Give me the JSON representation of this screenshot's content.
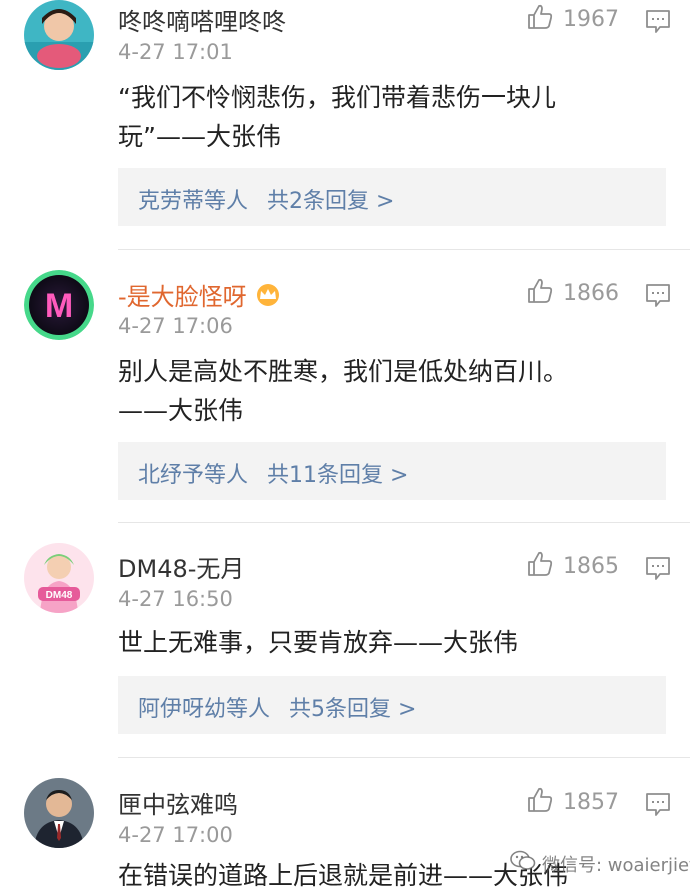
{
  "comments": [
    {
      "username": "咚咚嘀嗒哩咚咚",
      "time": "4-27 17:01",
      "likes": "1967",
      "content_lines": [
        "“我们不怜悯悲伤，我们带着悲伤一块儿",
        "玩”——大张伟"
      ],
      "replies_who": "克劳蒂等人",
      "replies_count": "共2条回复 >"
    },
    {
      "username": "-是大脸怪呀",
      "time": "4-27 17:06",
      "likes": "1866",
      "content_lines": [
        "别人是高处不胜寒，我们是低处纳百川。",
        "——大张伟"
      ],
      "replies_who": "北纾予等人",
      "replies_count": "共11条回复 >"
    },
    {
      "username": "DM48-无月",
      "time": "4-27 16:50",
      "likes": "1865",
      "content_lines": [
        "世上无难事，只要肯放弃——大张伟"
      ],
      "replies_who": "阿伊呀幼等人",
      "replies_count": "共5条回复 >"
    },
    {
      "username": "匣中弦难鸣",
      "time": "4-27 17:00",
      "likes": "1857",
      "content_lines": [
        "在错误的道路上后退就是前进——大张伟"
      ]
    }
  ],
  "avatar_badge_letter": "M",
  "avatar_badge_text": "DM48",
  "watermark": "微信号: woaierjiefu",
  "colors": {
    "link": "#5f7fa8",
    "meta": "#9a9a9a",
    "reply_bg": "#f3f3f3"
  }
}
